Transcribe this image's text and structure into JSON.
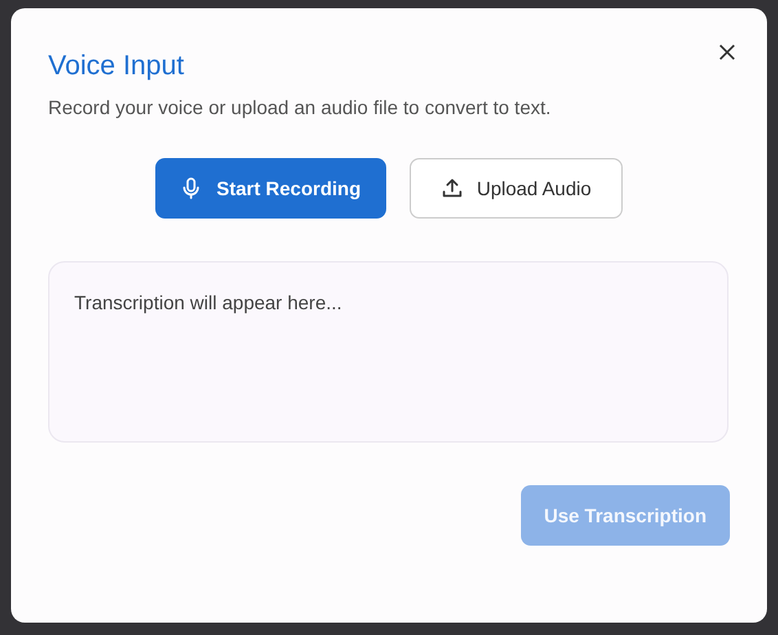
{
  "dialog": {
    "title": "Voice Input",
    "description": "Record your voice or upload an audio file to convert to text.",
    "actions": [
      {
        "kind": "record",
        "label": "Start Recording"
      },
      {
        "kind": "upload",
        "label": "Upload Audio"
      }
    ],
    "transcription": {
      "placeholder": "Transcription will appear here..."
    },
    "submit": {
      "label": "Use Transcription",
      "disabled": true
    }
  }
}
